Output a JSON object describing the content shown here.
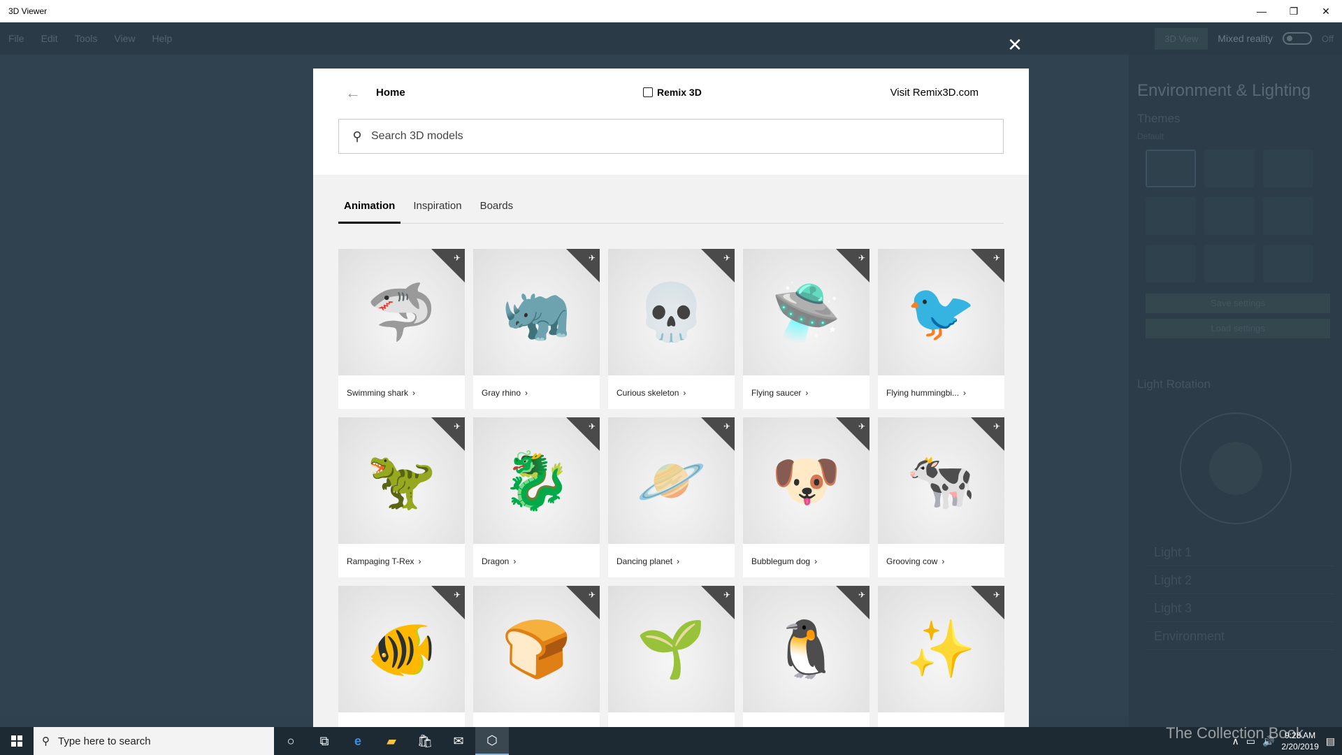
{
  "window": {
    "title": "3D Viewer",
    "minimize": "—",
    "restore": "❐",
    "close": "✕"
  },
  "menubar": {
    "items": [
      "File",
      "Edit",
      "Tools",
      "View",
      "Help"
    ],
    "mode_button": "3D View",
    "mixed_reality": "Mixed reality",
    "off": "Off"
  },
  "side_panel": {
    "title": "Environment & Lighting",
    "themes": "Themes",
    "themes_default": "Default",
    "save_button": "Save settings",
    "load_button": "Load settings",
    "light_rotation": "Light Rotation",
    "lights": [
      "Light 1",
      "Light 2",
      "Light 3",
      "Environment"
    ]
  },
  "overlay": {
    "close": "✕"
  },
  "modal": {
    "back": "←",
    "home": "Home",
    "brand": "Remix 3D",
    "visit": "Visit Remix3D.com",
    "search_placeholder": "Search 3D models",
    "tabs": [
      "Animation",
      "Inspiration",
      "Boards"
    ],
    "models": [
      {
        "label": "Swimming shark",
        "art": "🦈"
      },
      {
        "label": "Gray rhino",
        "art": "🦏"
      },
      {
        "label": "Curious skeleton",
        "art": "💀"
      },
      {
        "label": "Flying saucer",
        "art": "🛸"
      },
      {
        "label": "Flying hummingbi...",
        "art": "🐦"
      },
      {
        "label": "Rampaging T-Rex",
        "art": "🦖"
      },
      {
        "label": "Dragon",
        "art": "🐉"
      },
      {
        "label": "Dancing planet",
        "art": "🪐"
      },
      {
        "label": "Bubblegum dog",
        "art": "🐶"
      },
      {
        "label": "Grooving cow",
        "art": "🐄"
      },
      {
        "label": "",
        "art": "🐠"
      },
      {
        "label": "",
        "art": "🍞"
      },
      {
        "label": "",
        "art": "🌱"
      },
      {
        "label": "",
        "art": "🐧"
      },
      {
        "label": "",
        "art": "✨"
      }
    ]
  },
  "taskbar": {
    "search_placeholder": "Type here to search",
    "time": "9:28 AM",
    "date": "2/20/2019",
    "watermark": "The Collection Book"
  }
}
